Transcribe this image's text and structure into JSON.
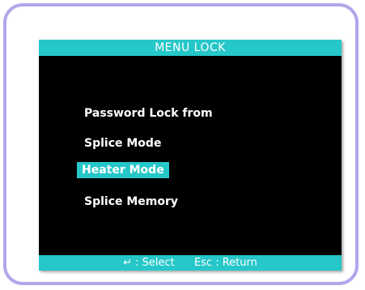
{
  "screen": {
    "title": "MENU LOCK",
    "accent_color": "#26c7c9",
    "background_color": "#000000",
    "frame_color": "#b0a8ec"
  },
  "menu": {
    "items": [
      {
        "label": "Password Lock from",
        "selected": false
      },
      {
        "label": "Splice Mode",
        "selected": false
      },
      {
        "label": "Heater Mode",
        "selected": true
      },
      {
        "label": "Splice Memory",
        "selected": false
      }
    ]
  },
  "status_bar": {
    "select_hint": "↵ : Select",
    "return_hint": "Esc : Return"
  }
}
